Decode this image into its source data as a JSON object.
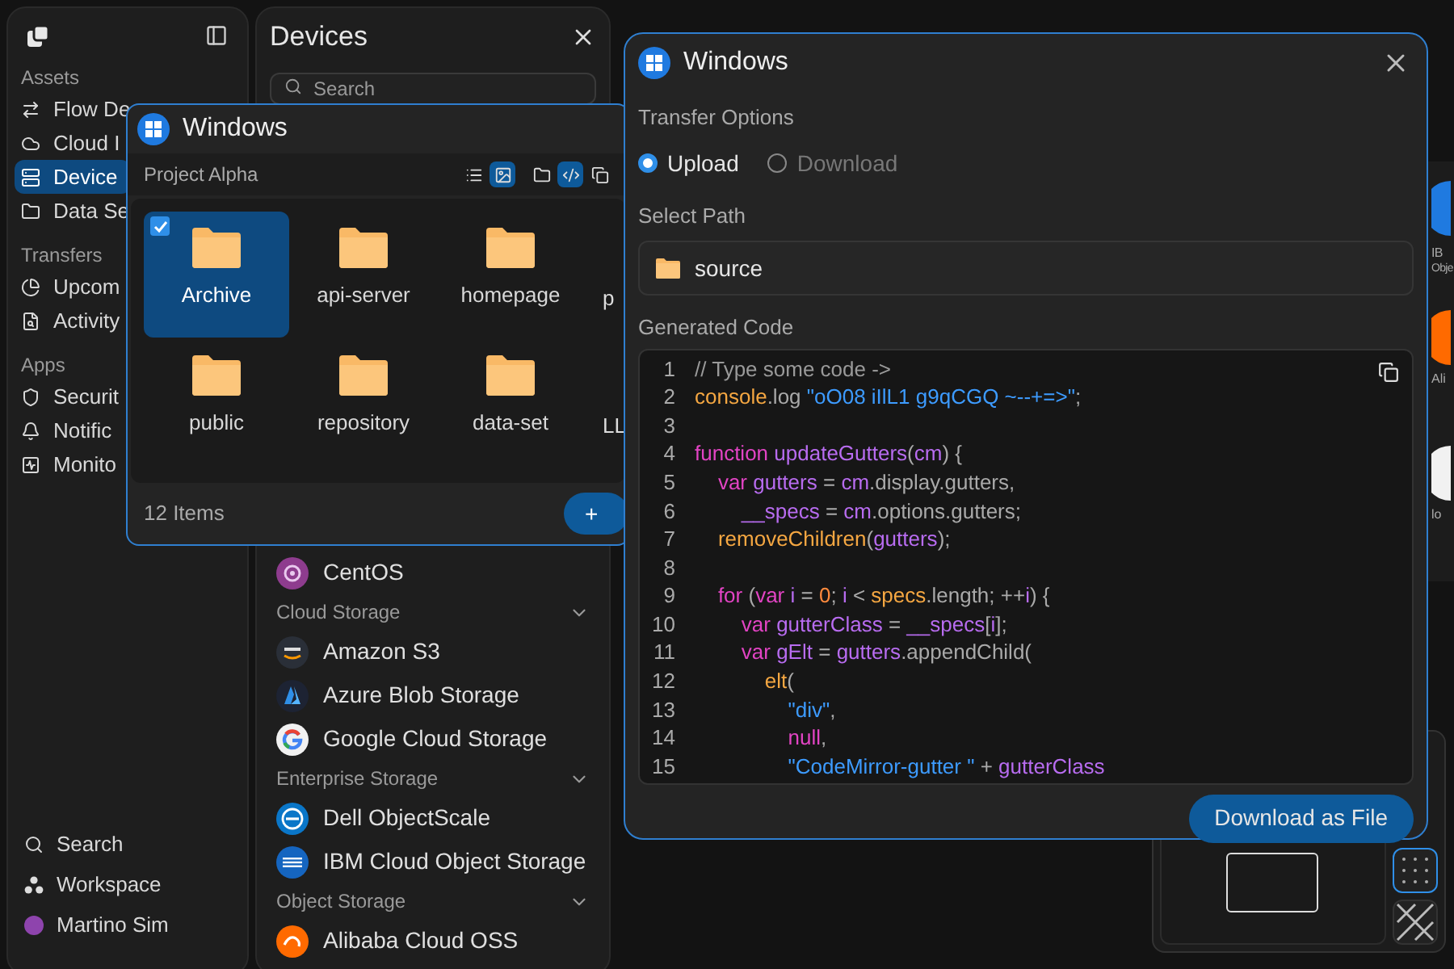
{
  "sidebar": {
    "sections": [
      {
        "title": "Assets",
        "items": [
          {
            "label": "Flow De",
            "selected": false
          },
          {
            "label": "Cloud I",
            "selected": false
          },
          {
            "label": "Device",
            "selected": true
          },
          {
            "label": "Data Se",
            "selected": false
          }
        ]
      },
      {
        "title": "Transfers",
        "items": [
          {
            "label": "Upcom",
            "selected": false
          },
          {
            "label": "Activity",
            "selected": false
          }
        ]
      },
      {
        "title": "Apps",
        "items": [
          {
            "label": "Securit",
            "selected": false
          },
          {
            "label": "Notific",
            "selected": false
          },
          {
            "label": "Monito",
            "selected": false
          }
        ]
      }
    ],
    "footer": [
      {
        "label": "Search"
      },
      {
        "label": "Workspace"
      }
    ],
    "user": {
      "name": "Martino Sim"
    }
  },
  "devices": {
    "title": "Devices",
    "search": {
      "placeholder": "Search"
    },
    "entries": [
      {
        "kind": "item",
        "label": "CentOS"
      },
      {
        "kind": "group",
        "label": "Cloud Storage",
        "expanded": true
      },
      {
        "kind": "item",
        "label": "Amazon S3"
      },
      {
        "kind": "item",
        "label": "Azure Blob Storage"
      },
      {
        "kind": "item",
        "label": "Google Cloud Storage"
      },
      {
        "kind": "group",
        "label": "Enterprise Storage",
        "expanded": true
      },
      {
        "kind": "item",
        "label": "Dell ObjectScale"
      },
      {
        "kind": "item",
        "label": "IBM Cloud Object Storage"
      },
      {
        "kind": "group",
        "label": "Object Storage",
        "expanded": true
      },
      {
        "kind": "item",
        "label": "Alibaba Cloud OSS"
      }
    ]
  },
  "explorer": {
    "title": "Windows",
    "path": "Project Alpha",
    "view_buttons": [
      {
        "selected": false
      },
      {
        "selected": true
      },
      {
        "selected": false
      },
      {
        "selected": true
      },
      {
        "selected": false
      }
    ],
    "folders": [
      {
        "kind": "folder",
        "label": "Archive",
        "selected": true
      },
      {
        "kind": "folder",
        "label": "api-server",
        "selected": false
      },
      {
        "kind": "folder",
        "label": "homepage",
        "selected": false
      },
      {
        "kind": "partial",
        "label": "p"
      },
      {
        "kind": "folder",
        "label": "public",
        "selected": false
      },
      {
        "kind": "folder",
        "label": "repository",
        "selected": false
      },
      {
        "kind": "folder",
        "label": "data-set",
        "selected": false
      },
      {
        "kind": "partial",
        "label": "LL"
      }
    ],
    "count": "12 Items",
    "add_button": "+"
  },
  "transfer": {
    "title": "Windows",
    "options_label": "Transfer Options",
    "options": [
      {
        "label": "Upload",
        "selected": true
      },
      {
        "label": "Download",
        "selected": false
      }
    ],
    "path_label": "Select Path",
    "path": "source",
    "code_label": "Generated Code",
    "code": [
      {
        "number": "1",
        "tokens": [
          {
            "text": "// Type some code ->",
            "kind": "comment"
          }
        ]
      },
      {
        "number": "2",
        "tokens": [
          {
            "text": "console",
            "kind": "function"
          },
          {
            "text": ".log ",
            "kind": "plain"
          },
          {
            "text": "\"oO08 iIlL1 g9qCGQ ~--+=>\"",
            "kind": "string"
          },
          {
            "text": ";",
            "kind": "plain"
          }
        ]
      },
      {
        "number": "3"
      },
      {
        "number": "4",
        "tokens": [
          {
            "text": "function ",
            "kind": "keyword"
          },
          {
            "text": "updateGutters",
            "kind": "variable"
          },
          {
            "text": "(",
            "kind": "plain"
          },
          {
            "text": "cm",
            "kind": "variable"
          },
          {
            "text": ") {",
            "kind": "plain"
          }
        ]
      },
      {
        "number": "5",
        "tokens": [
          {
            "text": "    var ",
            "kind": "keyword"
          },
          {
            "text": "gutters",
            "kind": "variable"
          },
          {
            "text": " = ",
            "kind": "plain"
          },
          {
            "text": "cm",
            "kind": "variable"
          },
          {
            "text": ".display.gutters,",
            "kind": "plain"
          }
        ]
      },
      {
        "number": "6",
        "tokens": [
          {
            "text": "        __specs",
            "kind": "variable"
          },
          {
            "text": " = ",
            "kind": "plain"
          },
          {
            "text": "cm",
            "kind": "variable"
          },
          {
            "text": ".options.gutters;",
            "kind": "plain"
          }
        ]
      },
      {
        "number": "7",
        "tokens": [
          {
            "text": "    removeChildren",
            "kind": "function"
          },
          {
            "text": "(",
            "kind": "plain"
          },
          {
            "text": "gutters",
            "kind": "variable"
          },
          {
            "text": ");",
            "kind": "plain"
          }
        ]
      },
      {
        "number": "8"
      },
      {
        "number": "9",
        "tokens": [
          {
            "text": "    for",
            "kind": "keyword"
          },
          {
            "text": " (",
            "kind": "plain"
          },
          {
            "text": "var ",
            "kind": "keyword"
          },
          {
            "text": "i",
            "kind": "variable"
          },
          {
            "text": " = ",
            "kind": "plain"
          },
          {
            "text": "0",
            "kind": "number"
          },
          {
            "text": "; ",
            "kind": "plain"
          },
          {
            "text": "i",
            "kind": "variable"
          },
          {
            "text": " < ",
            "kind": "plain"
          },
          {
            "text": "specs",
            "kind": "function"
          },
          {
            "text": ".length; ++",
            "kind": "plain"
          },
          {
            "text": "i",
            "kind": "variable"
          },
          {
            "text": ") {",
            "kind": "plain"
          }
        ]
      },
      {
        "number": "10",
        "tokens": [
          {
            "text": "        var ",
            "kind": "keyword"
          },
          {
            "text": "gutterClass",
            "kind": "variable"
          },
          {
            "text": " = ",
            "kind": "plain"
          },
          {
            "text": "__specs",
            "kind": "variable"
          },
          {
            "text": "[",
            "kind": "plain"
          },
          {
            "text": "i",
            "kind": "variable"
          },
          {
            "text": "];",
            "kind": "plain"
          }
        ]
      },
      {
        "number": "11",
        "tokens": [
          {
            "text": "        var ",
            "kind": "keyword"
          },
          {
            "text": "gElt",
            "kind": "variable"
          },
          {
            "text": " = ",
            "kind": "plain"
          },
          {
            "text": "gutters",
            "kind": "variable"
          },
          {
            "text": ".appendChild(",
            "kind": "plain"
          }
        ]
      },
      {
        "number": "12",
        "tokens": [
          {
            "text": "            elt",
            "kind": "function"
          },
          {
            "text": "(",
            "kind": "plain"
          }
        ]
      },
      {
        "number": "13",
        "tokens": [
          {
            "text": "                \"div\"",
            "kind": "string"
          },
          {
            "text": ",",
            "kind": "plain"
          }
        ]
      },
      {
        "number": "14",
        "tokens": [
          {
            "text": "                null",
            "kind": "keyword"
          },
          {
            "text": ",",
            "kind": "plain"
          }
        ]
      },
      {
        "number": "15",
        "tokens": [
          {
            "text": "                \"CodeMirror-gutter \"",
            "kind": "string"
          },
          {
            "text": " + ",
            "kind": "plain"
          },
          {
            "text": "gutterClass",
            "kind": "variable"
          }
        ]
      }
    ],
    "button": "Download as File"
  },
  "preview": {
    "tools": [
      {
        "selected": true
      },
      {
        "selected": false
      }
    ]
  },
  "edge_panel": {
    "labels": [
      "IB",
      "Obje",
      "Ali",
      "lo"
    ]
  }
}
